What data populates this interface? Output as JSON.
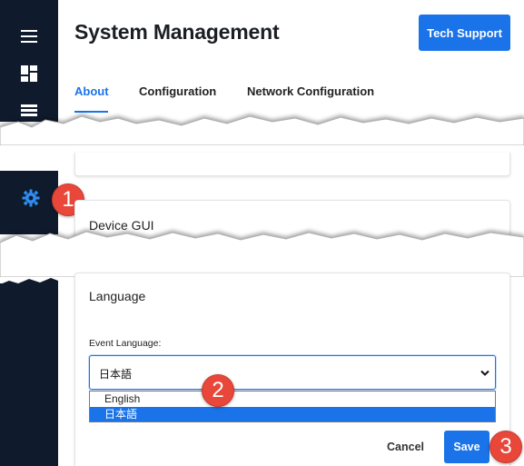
{
  "header": {
    "title": "System Management",
    "tech_support_label": "Tech Support"
  },
  "tabs": [
    {
      "label": "About",
      "active": true
    },
    {
      "label": "Configuration",
      "active": false
    },
    {
      "label": "Network Configuration",
      "active": false
    }
  ],
  "sidebar": {
    "icons": [
      "menu-icon",
      "dashboard-icon",
      "list-icon",
      "gear-icon"
    ]
  },
  "device_gui": {
    "title": "Device GUI"
  },
  "language_section": {
    "title": "Language",
    "field_label": "Event Language:",
    "selected_value": "日本語",
    "options": [
      "English",
      "日本語"
    ],
    "highlighted_option": "日本語"
  },
  "actions": {
    "cancel_label": "Cancel",
    "save_label": "Save"
  },
  "callouts": [
    "1",
    "2",
    "3"
  ],
  "colors": {
    "accent": "#1a73e8",
    "sidebar": "#0f1b2d",
    "callout": "#e8473a"
  }
}
